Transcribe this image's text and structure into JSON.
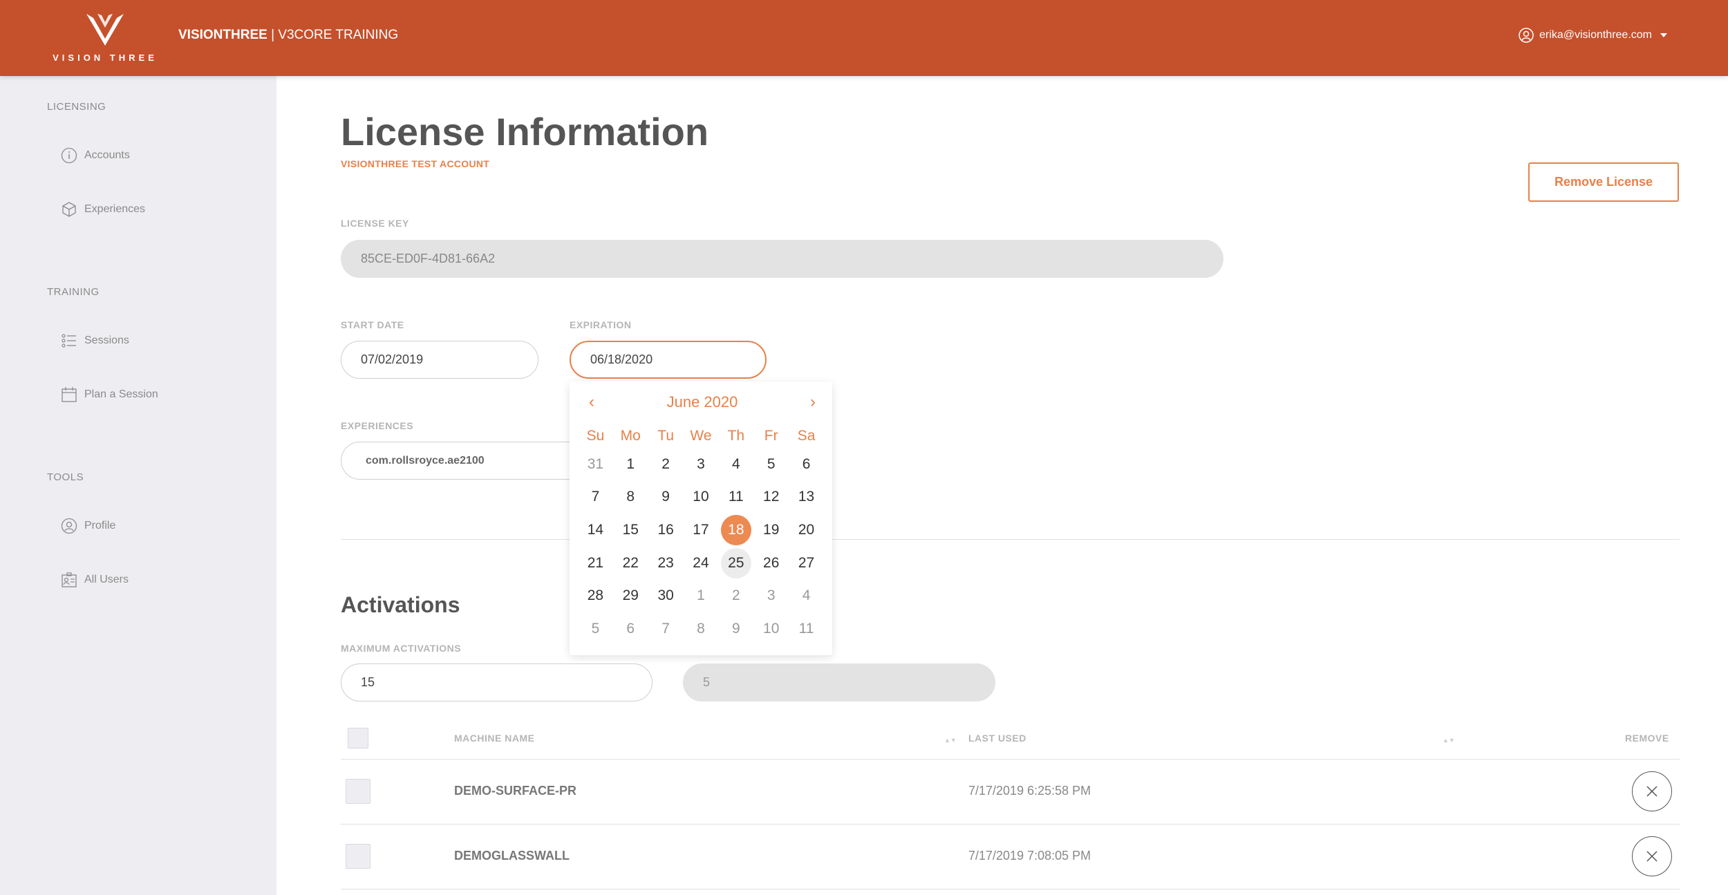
{
  "header": {
    "logo_text": "VISION THREE",
    "app_name": "VISIONTHREE",
    "app_separator": " | ",
    "app_subtitle": "V3CORE TRAINING",
    "user_email": "erika@visionthree.com"
  },
  "sidebar": {
    "sections": [
      {
        "label": "LICENSING",
        "items": [
          {
            "label": "Accounts",
            "icon": "info-icon"
          },
          {
            "label": "Experiences",
            "icon": "cube-icon"
          }
        ]
      },
      {
        "label": "TRAINING",
        "items": [
          {
            "label": "Sessions",
            "icon": "list-icon"
          },
          {
            "label": "Plan a Session",
            "icon": "calendar-icon"
          }
        ]
      },
      {
        "label": "TOOLS",
        "items": [
          {
            "label": "Profile",
            "icon": "user-icon"
          },
          {
            "label": "All Users",
            "icon": "id-card-icon"
          }
        ]
      }
    ]
  },
  "main": {
    "title": "License Information",
    "account_name": "VISIONTHREE TEST ACCOUNT",
    "remove_license_label": "Remove License",
    "license_key_label": "LICENSE KEY",
    "license_key_value": "85CE-ED0F-4D81-66A2",
    "start_date_label": "START DATE",
    "start_date_value": "07/02/2019",
    "expiration_label": "EXPIRATION",
    "expiration_value": "06/18/2020",
    "experiences_label": "EXPERIENCES",
    "experiences_value": "com.rollsroyce.ae2100"
  },
  "calendar": {
    "title": "June 2020",
    "prev": "‹",
    "next": "›",
    "weekdays": [
      "Su",
      "Mo",
      "Tu",
      "We",
      "Th",
      "Fr",
      "Sa"
    ],
    "weeks": [
      [
        {
          "d": "31",
          "m": true
        },
        {
          "d": "1"
        },
        {
          "d": "2"
        },
        {
          "d": "3"
        },
        {
          "d": "4"
        },
        {
          "d": "5"
        },
        {
          "d": "6"
        }
      ],
      [
        {
          "d": "7"
        },
        {
          "d": "8"
        },
        {
          "d": "9"
        },
        {
          "d": "10"
        },
        {
          "d": "11"
        },
        {
          "d": "12"
        },
        {
          "d": "13"
        }
      ],
      [
        {
          "d": "14"
        },
        {
          "d": "15"
        },
        {
          "d": "16"
        },
        {
          "d": "17"
        },
        {
          "d": "18",
          "s": true
        },
        {
          "d": "19"
        },
        {
          "d": "20"
        }
      ],
      [
        {
          "d": "21"
        },
        {
          "d": "22"
        },
        {
          "d": "23"
        },
        {
          "d": "24"
        },
        {
          "d": "25",
          "h": true
        },
        {
          "d": "26"
        },
        {
          "d": "27"
        }
      ],
      [
        {
          "d": "28"
        },
        {
          "d": "29"
        },
        {
          "d": "30"
        },
        {
          "d": "1",
          "m": true
        },
        {
          "d": "2",
          "m": true
        },
        {
          "d": "3",
          "m": true
        },
        {
          "d": "4",
          "m": true
        }
      ],
      [
        {
          "d": "5",
          "m": true
        },
        {
          "d": "6",
          "m": true
        },
        {
          "d": "7",
          "m": true
        },
        {
          "d": "8",
          "m": true
        },
        {
          "d": "9",
          "m": true
        },
        {
          "d": "10",
          "m": true
        },
        {
          "d": "11",
          "m": true
        }
      ]
    ]
  },
  "activations": {
    "title": "Activations",
    "max_label": "MAXIMUM ACTIVATIONS",
    "max_value": "15",
    "current_value": "5",
    "columns": {
      "machine": "MACHINE NAME",
      "last_used": "LAST USED",
      "remove": "REMOVE"
    },
    "rows": [
      {
        "machine": "DEMO-SURFACE-PR",
        "last_used": "7/17/2019 6:25:58 PM"
      },
      {
        "machine": "DEMOGLASSWALL",
        "last_used": "7/17/2019 7:08:05 PM"
      }
    ]
  },
  "colors": {
    "brand": "#c5502c",
    "accent": "#e8804a",
    "sidebar_bg": "#eeeef2"
  }
}
